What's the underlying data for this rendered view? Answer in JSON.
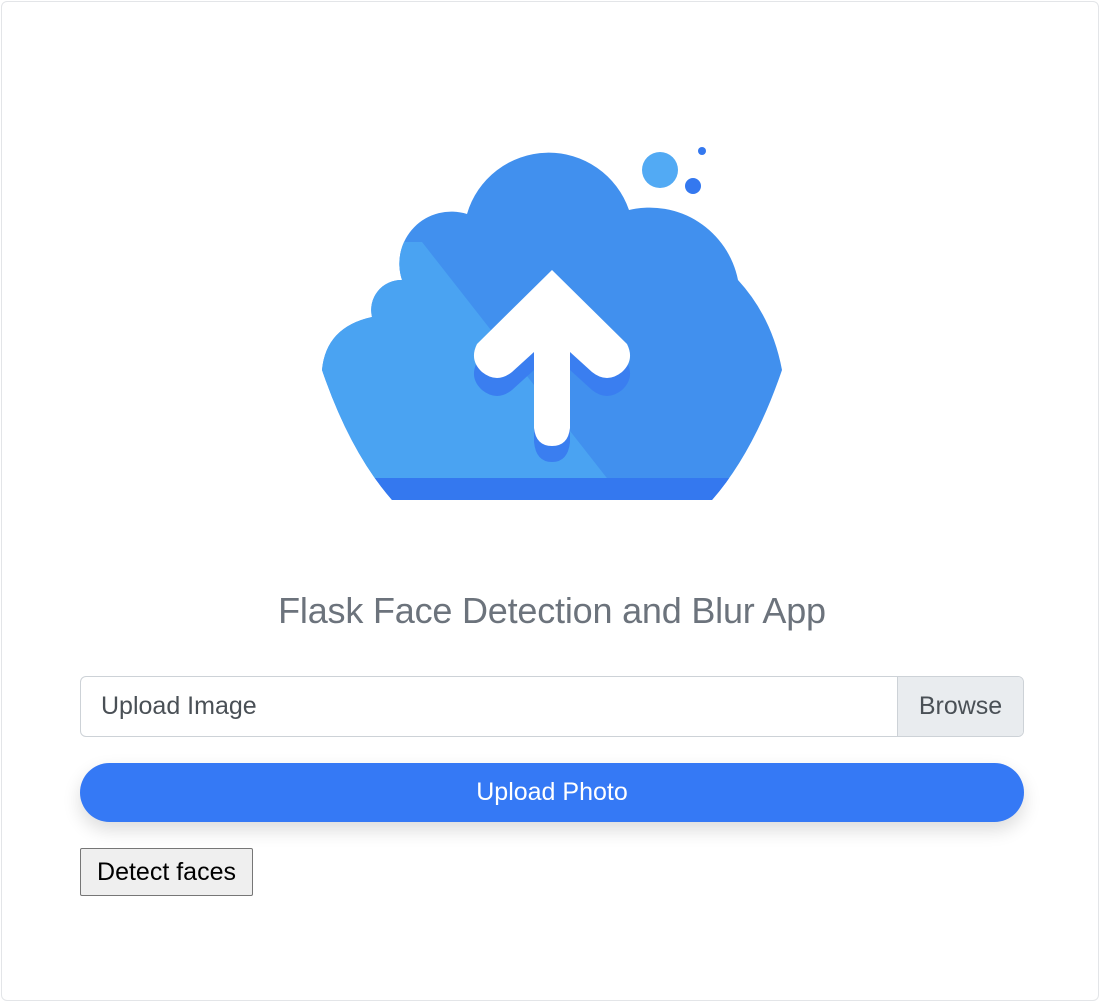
{
  "app": {
    "title": "Flask Face Detection and Blur App"
  },
  "illustration": {
    "icon": "cloud-upload-icon",
    "colors": {
      "cloud_light": "#4aa3f2",
      "cloud_main": "#4190ee",
      "cloud_base": "#3478ef",
      "arrow": "#ffffff",
      "arrow_shadow": "#3a7ef0",
      "bubble_light": "#52aaf4",
      "bubble_dark": "#3478ef"
    }
  },
  "upload_form": {
    "file_label": "Upload Image",
    "browse_label": "Browse",
    "submit_label": "Upload Photo",
    "accent_color": "#3579f5"
  },
  "actions": {
    "detect_label": "Detect faces"
  }
}
